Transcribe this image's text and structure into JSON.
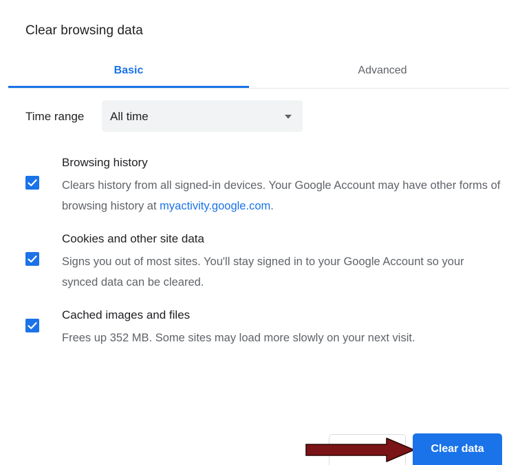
{
  "dialog": {
    "title": "Clear browsing data"
  },
  "tabs": [
    {
      "label": "Basic",
      "active": true
    },
    {
      "label": "Advanced",
      "active": false
    }
  ],
  "time_range": {
    "label": "Time range",
    "value": "All time"
  },
  "options": [
    {
      "title": "Browsing history",
      "desc_before_link": "Clears history from all signed-in devices. Your Google Account may have other forms of browsing history at ",
      "link": "myactivity.google.com",
      "desc_after_link": ".",
      "checked": true
    },
    {
      "title": "Cookies and other site data",
      "desc": "Signs you out of most sites. You'll stay signed in to your Google Account so your synced data can be cleared.",
      "checked": true
    },
    {
      "title": "Cached images and files",
      "desc": "Frees up 352 MB. Some sites may load more slowly on your next visit.",
      "checked": true
    }
  ],
  "footer": {
    "clear_label": "Clear data"
  },
  "colors": {
    "accent": "#1a73e8",
    "annotation_arrow": "#7b1416"
  }
}
